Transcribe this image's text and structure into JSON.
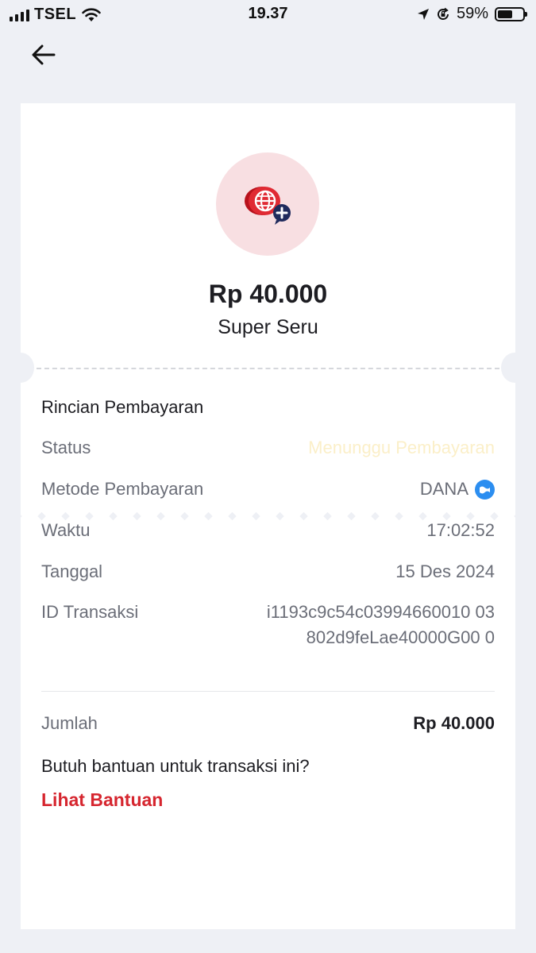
{
  "status_bar": {
    "carrier": "TSEL",
    "time": "19.37",
    "battery_percent": "59%",
    "battery_level": 0.59,
    "icons": [
      "signal-icon",
      "wifi-icon",
      "location-icon",
      "orientation-lock-icon",
      "battery-icon"
    ]
  },
  "nav": {
    "back_icon": "arrow-left-icon"
  },
  "receipt": {
    "product_icon": "globe-plus-icon",
    "amount": "Rp 40.000",
    "product_name": "Super Seru",
    "details_title": "Rincian Pembayaran",
    "rows": {
      "status": {
        "label": "Status",
        "value": "Menunggu Pembayaran"
      },
      "method": {
        "label": "Metode Pembayaran",
        "value": "DANA",
        "icon": "dana-icon"
      },
      "time": {
        "label": "Waktu",
        "value": "17:02:52"
      },
      "date": {
        "label": "Tanggal",
        "value": "15 Des 2024"
      },
      "transaction_id": {
        "label": "ID Transaksi",
        "value": "i1193c9c54c03994660010 03802d9feLae40000G00 0"
      }
    },
    "total_label": "Jumlah",
    "total_value": "Rp 40.000",
    "help_question": "Butuh bantuan untuk transaksi ini?",
    "help_link": "Lihat Bantuan"
  },
  "colors": {
    "accent_red": "#d6262f",
    "status_pending": "#fbefc8",
    "dana_blue": "#2c8ef0",
    "background": "#eef0f5"
  }
}
